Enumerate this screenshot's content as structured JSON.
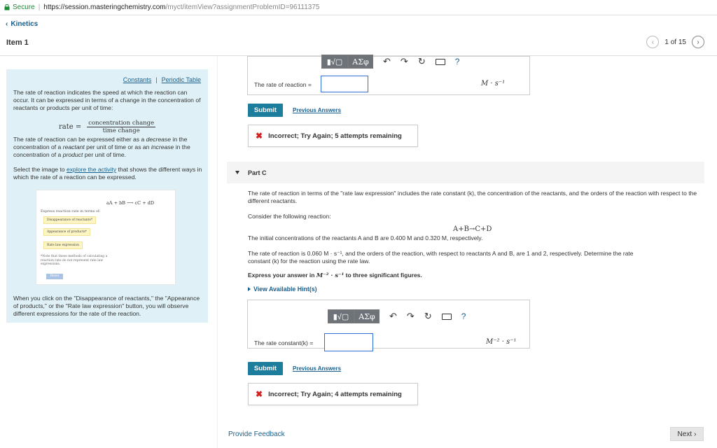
{
  "browser": {
    "secure_label": "Secure",
    "url_host": "https://session.masteringchemistry.com",
    "url_path": "/myct/itemView?assignmentProblemID=96111375"
  },
  "nav": {
    "back_label": "Kinetics",
    "item_title": "Item 1",
    "pager_text": "1 of 15",
    "prev_icon": "chevron-left-icon",
    "next_icon": "chevron-right-icon"
  },
  "left": {
    "constants_link": "Constants",
    "separator": "|",
    "periodic_link": "Periodic Table",
    "para1": "The rate of reaction indicates the speed at which the reaction can occur. It can be expressed in terms of a change in the concentration of reactants or products per unit of time:",
    "formula_lhs": "rate =",
    "formula_num": "concentration change",
    "formula_den": "time change",
    "para2_a": "The rate of reaction can be expressed either as a ",
    "para2_b": "decrease",
    "para2_c": " in the concentration of a ",
    "para2_d": "reactant",
    "para2_e": " per unit of time or as an ",
    "para2_f": "increase",
    "para2_g": " in the concentration of a ",
    "para2_h": "product",
    "para2_i": " per unit of time.",
    "para3_a": "Select the image to ",
    "para3_link": "explore the activity",
    "para3_b": " that shows the different ways in which the rate of a reaction can be expressed.",
    "activity": {
      "equation": "aA + bB ⟶ cC + dD",
      "title": "Express reaction rate in terms of:",
      "btn1": "Disappearance of reactants*",
      "btn2": "Appearance of products*",
      "btn3": "Rate law expression",
      "note": "*Note that these methods of calculating a reaction rate do not represent rate law expressions.",
      "reset": "Reset"
    },
    "para4": "When you click on the \"Disappearance of reactants,\" the \"Appearance of products,\" or the \"Rate law expression\" button, you will observe different expressions for the rate of the reaction."
  },
  "partB": {
    "toolbar": {
      "template_btn": "▮√▢",
      "greek_btn": "ΑΣφ",
      "undo_icon": "undo-icon",
      "redo_icon": "redo-icon",
      "reset_icon": "reset-icon",
      "keyboard_icon": "keyboard-icon",
      "help_label": "?"
    },
    "label": "The rate of reaction =",
    "input_value": "",
    "unit": "M · s⁻¹",
    "submit": "Submit",
    "previous_answers": "Previous Answers",
    "feedback": "Incorrect; Try Again; 5 attempts remaining",
    "feedback_icon": "x-icon"
  },
  "partC": {
    "header": "Part C",
    "p1": "The rate of reaction in terms of the \"rate law expression\" includes the rate constant (k), the concentration of the reactants, and the orders of the reaction with respect to the different reactants.",
    "p2": "Consider the following reaction:",
    "reaction": "A+B→C+D",
    "p3": "The initial concentrations of the reactants A and B are 0.400 M and 0.320 M, respectively.",
    "p4": "The rate of reaction is 0.060 M · s⁻¹, and the orders of the reaction, with respect to reactants A and B, are 1 and 2, respectively. Determine the rate constant (k) for the reaction using the rate law.",
    "p5_a": "Express your answer in ",
    "p5_unit": "M⁻² · s⁻¹",
    "p5_b": " to three significant figures.",
    "hint": "View Available Hint(s)",
    "label": "The rate constant(k) =",
    "input_value": "",
    "unit": "M⁻² · s⁻¹",
    "submit": "Submit",
    "previous_answers": "Previous Answers",
    "feedback": "Incorrect; Try Again; 4 attempts remaining"
  },
  "footer": {
    "provide_feedback": "Provide Feedback",
    "next": "Next"
  }
}
